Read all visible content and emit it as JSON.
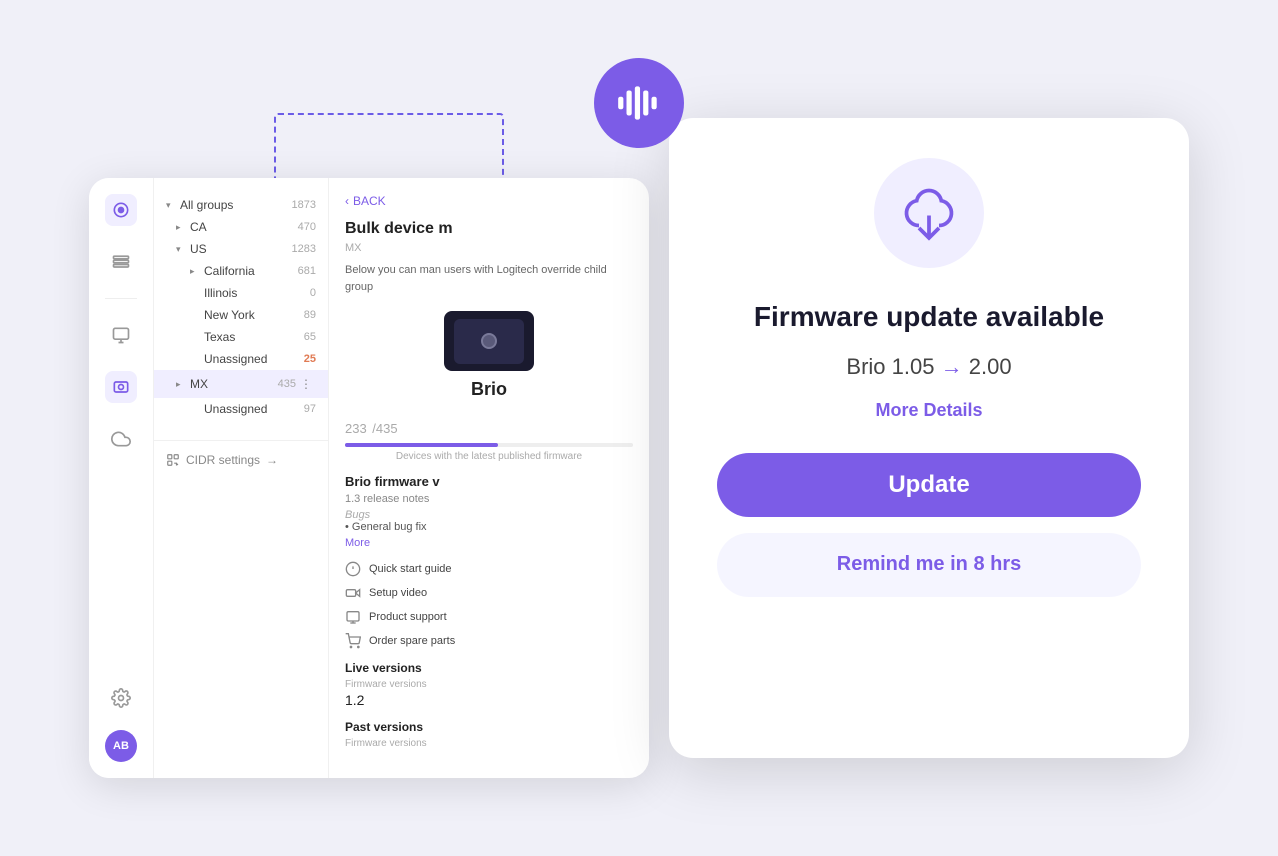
{
  "scene": {
    "voice_icon": "waveform-icon",
    "dashed_border": true
  },
  "sidebar": {
    "icons": [
      {
        "name": "circle-icon",
        "active": true,
        "unicode": "⊙"
      },
      {
        "name": "layers-icon",
        "active": false,
        "unicode": "▤"
      },
      {
        "name": "monitor-icon",
        "active": false,
        "unicode": "▣"
      },
      {
        "name": "device-icon",
        "active": false,
        "unicode": "⊞"
      },
      {
        "name": "cloud-icon",
        "active": false,
        "unicode": "☁"
      }
    ],
    "bottom": {
      "settings_icon": "gear-icon",
      "avatar_text": "AB"
    },
    "cidr_label": "CIDR settings"
  },
  "groups": {
    "items": [
      {
        "label": "All groups",
        "count": "1873",
        "indent": 0,
        "expanded": true,
        "toggle": "▾"
      },
      {
        "label": "CA",
        "count": "470",
        "indent": 1,
        "expanded": false,
        "toggle": "▸"
      },
      {
        "label": "US",
        "count": "1283",
        "indent": 1,
        "expanded": true,
        "toggle": "▾"
      },
      {
        "label": "California",
        "count": "681",
        "indent": 2,
        "expanded": false,
        "toggle": "▸"
      },
      {
        "label": "Illinois",
        "count": "0",
        "indent": 2,
        "expanded": false,
        "toggle": ""
      },
      {
        "label": "New York",
        "count": "89",
        "indent": 2,
        "expanded": false,
        "toggle": ""
      },
      {
        "label": "Texas",
        "count": "65",
        "indent": 2,
        "expanded": false,
        "toggle": ""
      },
      {
        "label": "Unassigned",
        "count": "25",
        "indent": 2,
        "count_highlight": true
      },
      {
        "label": "MX",
        "count": "435",
        "indent": 1,
        "expanded": false,
        "toggle": "▸",
        "selected": true,
        "has_more": true
      },
      {
        "label": "Unassigned",
        "count": "97",
        "indent": 2
      }
    ]
  },
  "device_panel": {
    "back_label": "BACK",
    "bulk_title": "Bulk device m",
    "bulk_subtitle": "MX",
    "bulk_desc": "Below you can man users with Logitech override child group",
    "device_name": "Brio",
    "firmware_section_title": "Brio firmware v",
    "release_notes_label": "1.3 release notes",
    "bugs_label": "Bugs",
    "bug_item": "General bug fix",
    "more_label": "More",
    "progress_current": "233",
    "progress_total": "435",
    "progress_percent": 53,
    "progress_desc": "Devices with the latest published firmware",
    "live_versions_label": "Live versions",
    "firmware_versions_label": "Firmware versions",
    "live_version_value": "1.2",
    "past_versions_label": "Past versions",
    "past_firmware_label": "Firmware versions",
    "links": [
      {
        "label": "Quick start guide",
        "icon": "guide-icon"
      },
      {
        "label": "Setup video",
        "icon": "video-icon"
      },
      {
        "label": "Product support",
        "icon": "support-icon"
      },
      {
        "label": "Order spare parts",
        "icon": "cart-icon"
      }
    ]
  },
  "firmware_modal": {
    "icon": "download-cloud-icon",
    "title": "Firmware update available",
    "version_from": "Brio 1.05",
    "version_arrow": "→",
    "version_to": "2.00",
    "more_details_label": "More Details",
    "update_button_label": "Update",
    "remind_button_label": "Remind me in 8 hrs"
  },
  "colors": {
    "accent": "#7c5ce7",
    "accent_light": "#f0eeff",
    "orange": "#e07b54"
  }
}
